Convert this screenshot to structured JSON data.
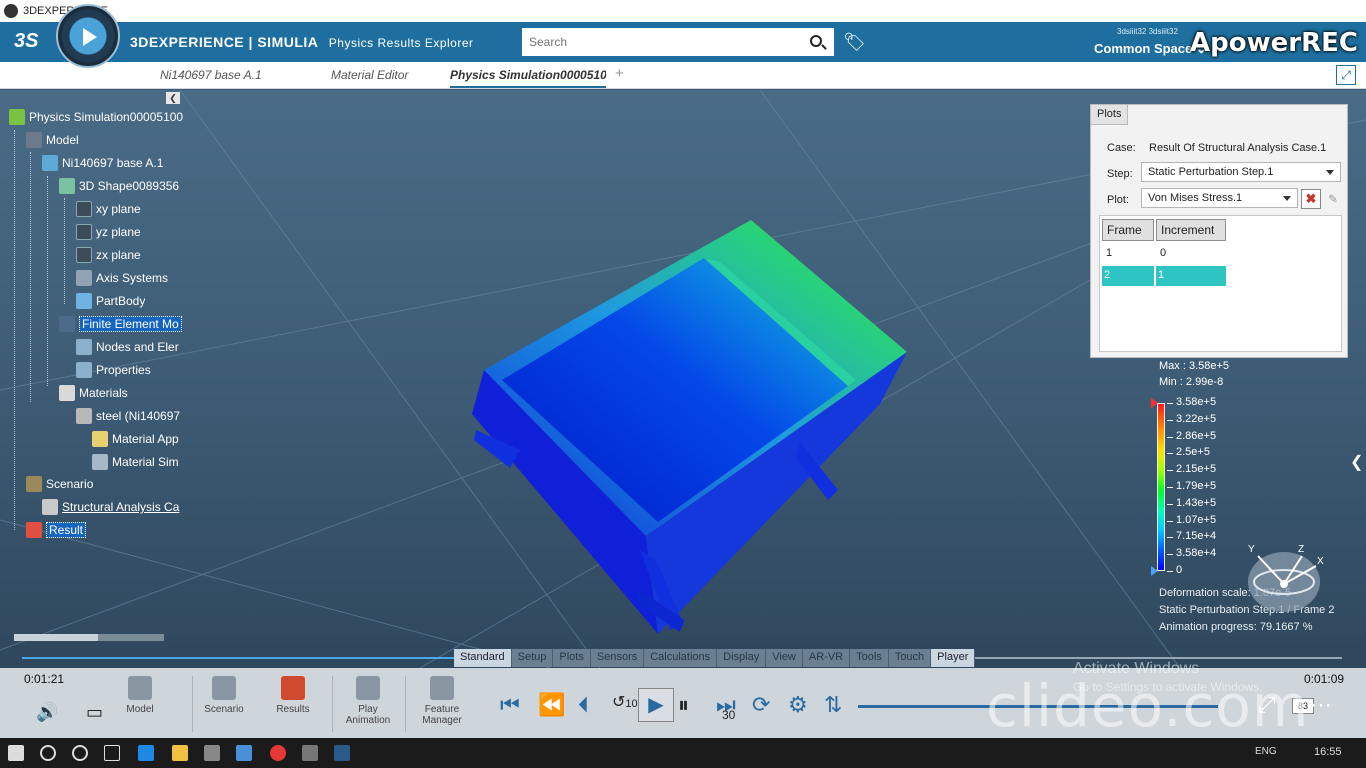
{
  "window": {
    "title": "3DEXPERIENCE"
  },
  "header": {
    "brand_bold": "3DEXPERIENCE | SIMULIA",
    "app_name": "Physics Results Explorer",
    "search_placeholder": "Search",
    "user_ids": "3dsiiit32 3dsiiit32",
    "space": "Common Space",
    "recorder_watermark": "ApowerREC"
  },
  "tabs": [
    {
      "label": "Ni140697 base A.1"
    },
    {
      "label": "Material Editor"
    },
    {
      "label": "Physics Simulation0000510"
    }
  ],
  "tree": {
    "root": "Physics Simulation00005100",
    "model": "Model",
    "product": "Ni140697 base A.1",
    "shape": "3D Shape0089356",
    "xy": "xy plane",
    "yz": "yz plane",
    "zx": "zx plane",
    "axis": "Axis Systems",
    "partbody": "PartBody",
    "fem": "Finite Element Mo",
    "nodes": "Nodes and Eler",
    "properties": "Properties",
    "materials": "Materials",
    "steel": "steel (Ni140697",
    "mat_app": "Material App",
    "mat_sim": "Material Sim",
    "scenario": "Scenario",
    "structural": "Structural Analysis Ca",
    "result": "Result"
  },
  "plots_panel": {
    "tab": "Plots",
    "case_label": "Case:",
    "case_value": "Result Of Structural Analysis Case.1",
    "step_label": "Step:",
    "step_value": "Static Perturbation Step.1",
    "plot_label": "Plot:",
    "plot_value": "Von Mises Stress.1",
    "frame_header": "Frame",
    "increment_header": "Increment",
    "rows": [
      {
        "frame": "1",
        "increment": "0"
      },
      {
        "frame": "2",
        "increment": "1"
      }
    ]
  },
  "legend": {
    "max": "Max : 3.58e+5",
    "min": "Min : 2.99e-8",
    "values": [
      "3.58e+5",
      "3.22e+5",
      "2.86e+5",
      "2.5e+5",
      "2.15e+5",
      "1.79e+5",
      "1.43e+5",
      "1.07e+5",
      "7.15e+4",
      "3.58e+4",
      "0"
    ],
    "deformation": "Deformation scale: 1.87e-5",
    "step_frame": "Static Perturbation Step.1 / Frame 2",
    "animation": "Animation progress: 79.1667 %",
    "colors": [
      "#ff1a1a",
      "#ffe000",
      "#00ff20",
      "#00c8ff",
      "#0000ff"
    ]
  },
  "triad": {
    "x": "X",
    "y": "Y",
    "z": "Z"
  },
  "command_tabs": [
    "Standard",
    "Setup",
    "Plots",
    "Sensors",
    "Calculations",
    "Display",
    "View",
    "AR-VR",
    "Tools",
    "Touch",
    "Player"
  ],
  "bottom": {
    "time_left": "0:01:21",
    "time_right": "0:01:09",
    "tools": [
      "Model",
      "Scenario",
      "Results",
      "Play Animation",
      "Feature Manager"
    ],
    "skip_back": "10",
    "skip_fwd": "30",
    "speed": "83",
    "clideo_watermark": "clideo.com",
    "activate_title": "Activate Windows",
    "activate_sub": "Go to Settings to activate Windows."
  },
  "taskbar": {
    "lang": "ENG",
    "clock": "16:55"
  }
}
